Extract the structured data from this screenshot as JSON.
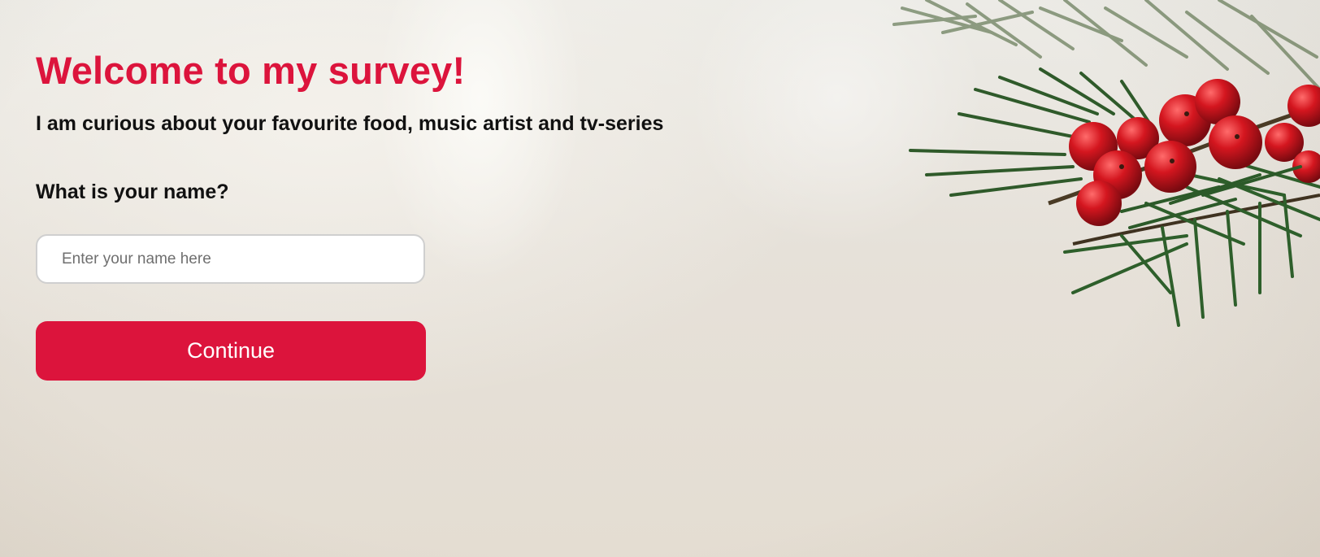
{
  "page": {
    "title": "Welcome to my survey!",
    "subtitle": "I am curious about your favourite food, music artist and tv-series"
  },
  "form": {
    "question": "What is your name?",
    "name_input": {
      "value": "",
      "placeholder": "Enter your name here"
    },
    "continue_label": "Continue"
  },
  "colors": {
    "accent": "#dc143c",
    "text": "#111111",
    "background": "#e8e4dc"
  },
  "decoration": {
    "image": "pine-branch-with-red-berries"
  }
}
